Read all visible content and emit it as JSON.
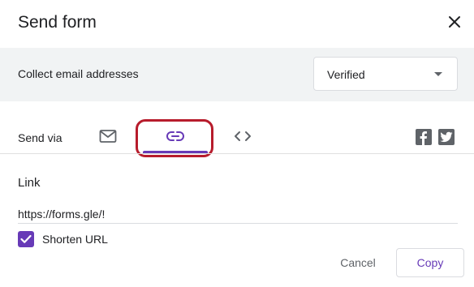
{
  "dialog": {
    "title": "Send form"
  },
  "collect": {
    "label": "Collect email addresses",
    "selected": "Verified"
  },
  "send_via": {
    "label": "Send via",
    "tabs": [
      {
        "icon": "email-icon",
        "active": false
      },
      {
        "icon": "link-icon",
        "active": true
      },
      {
        "icon": "embed-code-icon",
        "active": false
      }
    ],
    "social": [
      "facebook-icon",
      "twitter-icon"
    ]
  },
  "link": {
    "heading": "Link",
    "url": "https://forms.gle/!",
    "shorten_label": "Shorten URL",
    "shorten_checked": true
  },
  "actions": {
    "cancel": "Cancel",
    "copy": "Copy"
  },
  "colors": {
    "accent": "#673ab7",
    "highlight": "#b71c2c",
    "band": "#f1f3f4"
  }
}
